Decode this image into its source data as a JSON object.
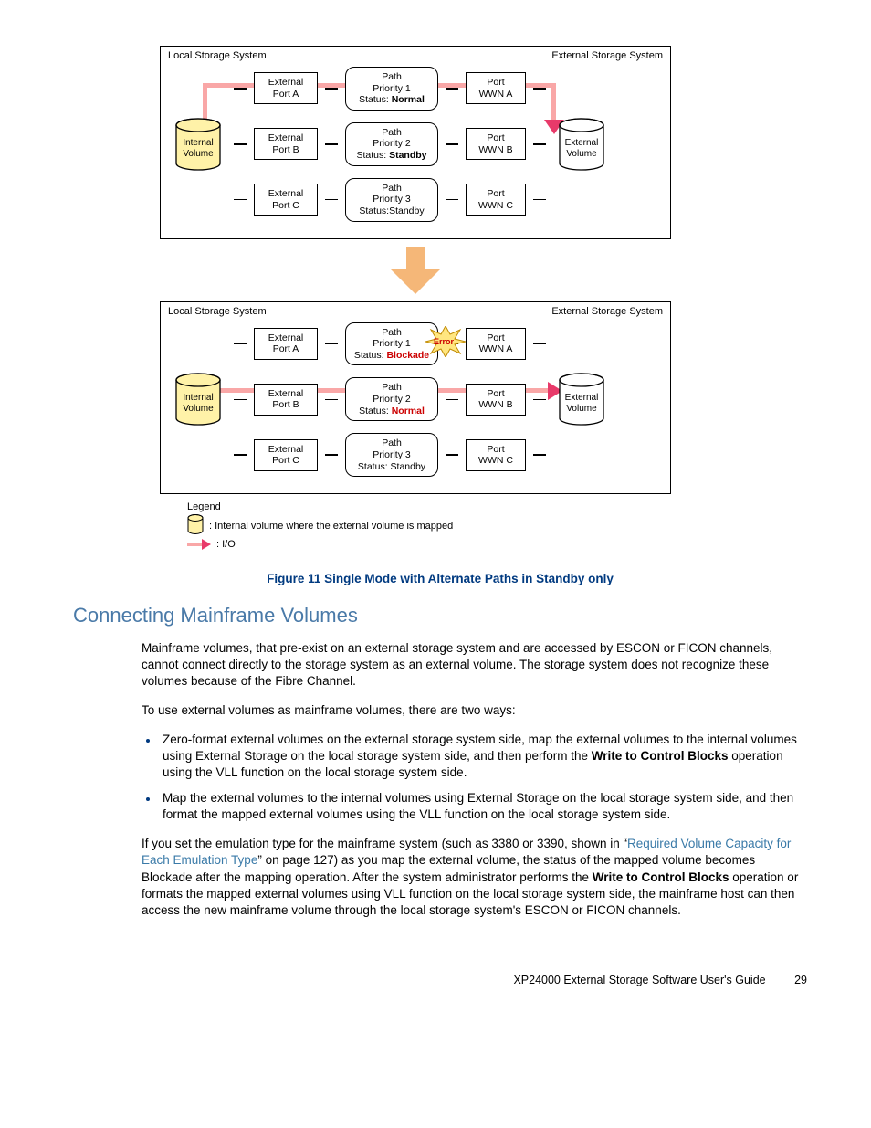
{
  "diagram": {
    "top": {
      "local_label": "Local Storage System",
      "ext_label": "External Storage System",
      "internal_vol": "Internal\nVolume",
      "external_vol": "External\nVolume",
      "rows": [
        {
          "port": "External\nPort A",
          "path": "Path\nPriority 1",
          "status_prefix": "Status: ",
          "status": "Normal",
          "status_bold": true,
          "status_red": false,
          "wwn": "Port\nWWN A"
        },
        {
          "port": "External\nPort B",
          "path": "Path\nPriority 2",
          "status_prefix": "Status: ",
          "status": "Standby",
          "status_bold": true,
          "status_red": false,
          "wwn": "Port\nWWN B"
        },
        {
          "port": "External\nPort C",
          "path": "Path\nPriority 3",
          "status_prefix": "Status:",
          "status": "Standby",
          "status_bold": false,
          "status_red": false,
          "wwn": "Port\nWWN C"
        }
      ]
    },
    "bottom": {
      "local_label": "Local Storage System",
      "ext_label": "External Storage System",
      "internal_vol": "Internal\nVolume",
      "external_vol": "External\nVolume",
      "error_label": "Error",
      "rows": [
        {
          "port": "External\nPort A",
          "path": "Path\nPriority 1",
          "status_prefix": "Status: ",
          "status": "Blockade",
          "status_bold": true,
          "status_red": true,
          "wwn": "Port\nWWN A"
        },
        {
          "port": "External\nPort B",
          "path": "Path\nPriority 2",
          "status_prefix": "Status: ",
          "status": "Normal",
          "status_bold": true,
          "status_red": true,
          "wwn": "Port\nWWN B"
        },
        {
          "port": "External\nPort C",
          "path": "Path\nPriority 3",
          "status_prefix": "Status: ",
          "status": "Standby",
          "status_bold": false,
          "status_red": false,
          "wwn": "Port\nWWN C"
        }
      ]
    },
    "legend_title": "Legend",
    "legend_vol": ": Internal volume where the external volume is mapped",
    "legend_io": ": I/O"
  },
  "caption": "Figure 11 Single Mode with Alternate Paths in Standby only",
  "heading": "Connecting Mainframe Volumes",
  "para1": "Mainframe volumes, that pre-exist on an external storage system and are accessed by ESCON or FICON channels, cannot connect directly to the storage system as an external volume. The storage system does not recognize these volumes because of the Fibre Channel.",
  "para2": "To use external volumes as mainframe volumes, there are two ways:",
  "bullet1_a": "Zero-format external volumes on the external storage system side, map the external volumes to the internal volumes using External Storage on the local storage system side, and then perform the ",
  "bullet1_bold": "Write to Control Blocks",
  "bullet1_b": " operation using the VLL function on the local storage system side.",
  "bullet2": "Map the external volumes to the internal volumes using External Storage on the local storage system side, and then format the mapped external volumes using the VLL function on the local storage system side.",
  "para3_a": "If you set the emulation type for the mainframe system (such as 3380 or 3390, shown in “",
  "para3_link": "Required Volume Capacity for Each Emulation Type",
  "para3_b": "” on page 127) as you map the external volume, the status of the mapped volume becomes Blockade after the mapping operation. After the system administrator performs the ",
  "para3_bold": "Write to Control Blocks",
  "para3_c": " operation or formats the mapped external volumes using VLL function on the local storage system side, the mainframe host can then access the new mainframe volume through the local storage system's ESCON or FICON channels.",
  "footer_title": "XP24000 External Storage Software User's Guide",
  "footer_page": "29"
}
